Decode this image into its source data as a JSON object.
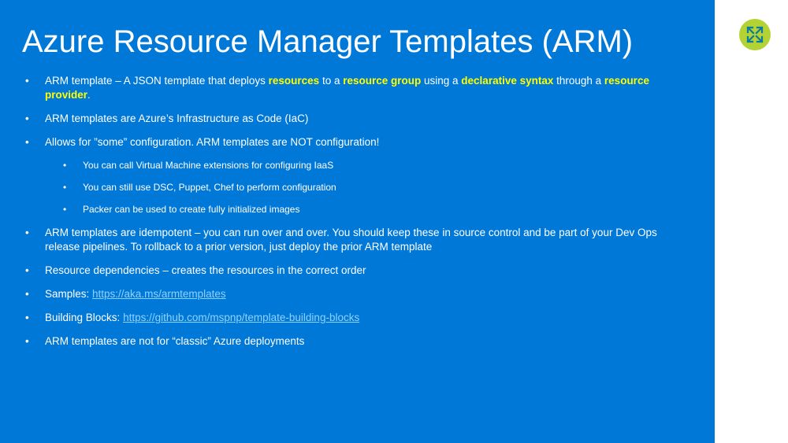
{
  "slide": {
    "title": "Azure Resource Manager Templates (ARM)",
    "logo_icon": "expand-arrows-icon",
    "colors": {
      "background": "#0078d7",
      "highlight": "#ffff00",
      "link": "#8fd1ff",
      "logo": "#b3d334"
    }
  },
  "bullets": {
    "b1": {
      "t1": "ARM template – A JSON template that deploys ",
      "h1": "resources",
      "t2": " to a ",
      "h2": "resource group",
      "t3": " using a ",
      "h3": "declarative syntax",
      "t4": " through a ",
      "h4": "resource provider",
      "t5": "."
    },
    "b2": "ARM templates are Azure’s Infrastructure as Code (IaC)",
    "b3": "Allows for ”some” configuration.  ARM templates are NOT configuration!",
    "sub": [
      "You can call Virtual Machine extensions for configuring IaaS",
      "You can still use DSC, Puppet, Chef to perform configuration",
      "Packer can  be used to create fully initialized images"
    ],
    "b4": "ARM templates are idempotent – you can run over and over.  You should keep these in source control and be part of your Dev Ops release pipelines.  To rollback to a prior version, just deploy the prior ARM template",
    "b5": "Resource dependencies – creates the resources in the correct order",
    "b6": {
      "label": "Samples: ",
      "link": "https://aka.ms/armtemplates"
    },
    "b7": {
      "label": "Building Blocks: ",
      "link": "https://github.com/mspnp/template-building-blocks"
    },
    "b8": "ARM templates are not for “classic” Azure deployments",
    "bullet_char": "•"
  }
}
